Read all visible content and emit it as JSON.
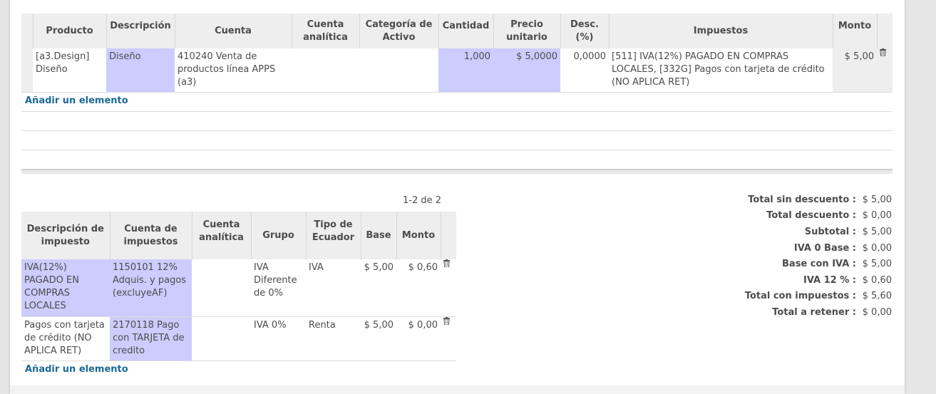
{
  "lines": {
    "headers": {
      "product": "Producto",
      "description": "Descripción",
      "account": "Cuenta",
      "analytic": "Cuenta analítica",
      "asset_category": "Categoría de Activo",
      "quantity": "Cantidad",
      "unit_price": "Precio unitario",
      "discount": "Desc. (%)",
      "taxes": "Impuestos",
      "amount": "Monto"
    },
    "rows": [
      {
        "product": "[a3.Design] Diseño",
        "description": "Diseño",
        "account": "410240 Venta de productos línea APPS (a3)",
        "analytic": "",
        "asset_category": "",
        "quantity": "1,000",
        "unit_price": "$ 5,0000",
        "discount": "0,0000",
        "taxes": "[511] IVA(12%) PAGADO EN COMPRAS LOCALES, [332G] Pagos con tarjeta de crédito (NO APLICA RET)",
        "amount": "$ 5,00"
      }
    ],
    "add_label": "Añadir un elemento"
  },
  "pager": "1-2 de 2",
  "taxes": {
    "headers": {
      "description": "Descripción de impuesto",
      "account": "Cuenta de impuestos",
      "analytic": "Cuenta analítica",
      "group": "Grupo",
      "ecuador_type": "Tipo de Ecuador",
      "base": "Base",
      "amount": "Monto"
    },
    "rows": [
      {
        "description": "IVA(12%) PAGADO EN COMPRAS LOCALES",
        "account": "1150101 12% Adquis. y pagos (excluyeAF)",
        "analytic": "",
        "group": "IVA Diferente de 0%",
        "ecuador_type": "IVA",
        "base": "$ 5,00",
        "amount": "$ 0,60"
      },
      {
        "description": "Pagos con tarjeta de crédito (NO APLICA RET)",
        "account": "2170118 Pago con TARJETA de credito",
        "analytic": "",
        "group": "IVA 0%",
        "ecuador_type": "Renta",
        "base": "$ 5,00",
        "amount": "$ 0,00"
      }
    ],
    "add_label": "Añadir un elemento"
  },
  "totals": [
    {
      "label": "Total sin descuento :",
      "value": "$ 5,00"
    },
    {
      "label": "Total descuento :",
      "value": "$ 0,00"
    },
    {
      "label": "Subtotal :",
      "value": "$ 5,00"
    },
    {
      "label": "IVA 0 Base :",
      "value": "$ 0,00"
    },
    {
      "label": "Base con IVA :",
      "value": "$ 5,00"
    },
    {
      "label": "IVA 12 % :",
      "value": "$ 0,60"
    },
    {
      "label": "Total con impuestos :",
      "value": "$ 5,60"
    },
    {
      "label": "Total a retener :",
      "value": "$ 0,00"
    }
  ],
  "colors": {
    "highlight": "#ccccff",
    "link": "#1a6a99",
    "header_bg": "#eeeeee"
  }
}
